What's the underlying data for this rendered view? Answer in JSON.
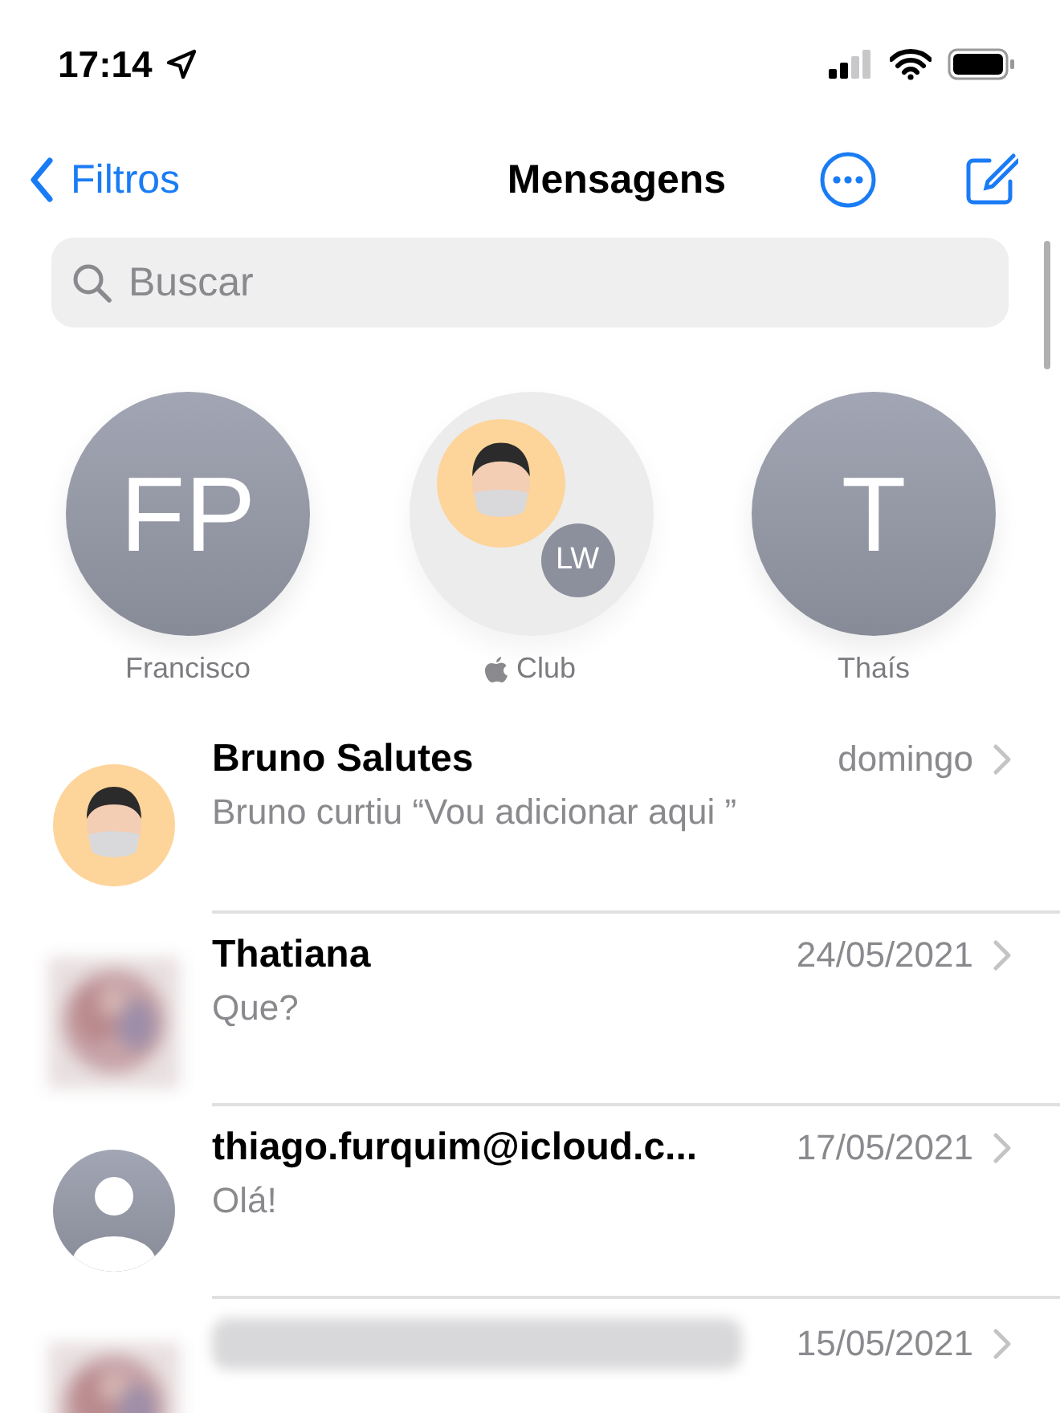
{
  "status_bar": {
    "time": "17:14"
  },
  "nav": {
    "back_label": "Filtros",
    "title": "Mensagens"
  },
  "search": {
    "placeholder": "Buscar"
  },
  "pinned": [
    {
      "kind": "initials",
      "initials": "FP",
      "name": "Francisco"
    },
    {
      "kind": "group",
      "badge": "LW",
      "name": "Club"
    },
    {
      "kind": "initials",
      "initials": "T",
      "name": "Thaís"
    }
  ],
  "conversations": [
    {
      "kind": "memoji",
      "name": "Bruno Salutes",
      "date": "domingo",
      "preview": "Bruno curtiu “Vou adicionar aqui ”"
    },
    {
      "name": "Thatiana",
      "date": "24/05/2021",
      "preview": "Que?"
    },
    {
      "kind": "placeholder",
      "name": "thiago.furquim@icloud.c...",
      "date": "17/05/2021",
      "preview": "Olá!"
    },
    {
      "name_blurred": true,
      "date": "15/05/2021"
    }
  ]
}
